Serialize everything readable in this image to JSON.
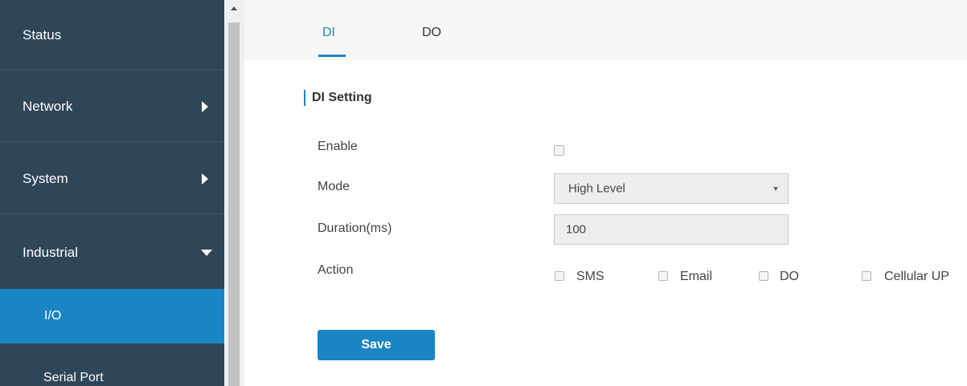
{
  "sidebar": {
    "items": [
      {
        "label": "Status"
      },
      {
        "label": "Network"
      },
      {
        "label": "System"
      },
      {
        "label": "Industrial"
      }
    ],
    "subitems": [
      {
        "label": "I/O",
        "active": true
      },
      {
        "label": "Serial Port",
        "active": false
      }
    ]
  },
  "tabs": [
    {
      "label": "DI",
      "active": true
    },
    {
      "label": "DO",
      "active": false
    }
  ],
  "section": {
    "title": "DI Setting"
  },
  "form": {
    "enable": {
      "label": "Enable",
      "checked": false
    },
    "mode": {
      "label": "Mode",
      "value": "High Level"
    },
    "duration": {
      "label": "Duration(ms)",
      "value": "100"
    },
    "action": {
      "label": "Action",
      "options": [
        {
          "label": "SMS",
          "checked": false
        },
        {
          "label": "Email",
          "checked": false
        },
        {
          "label": "DO",
          "checked": false
        },
        {
          "label": "Cellular UP",
          "checked": false
        }
      ]
    },
    "save_label": "Save"
  },
  "colors": {
    "sidebar_bg": "#2f4558",
    "accent": "#1a85c4"
  }
}
